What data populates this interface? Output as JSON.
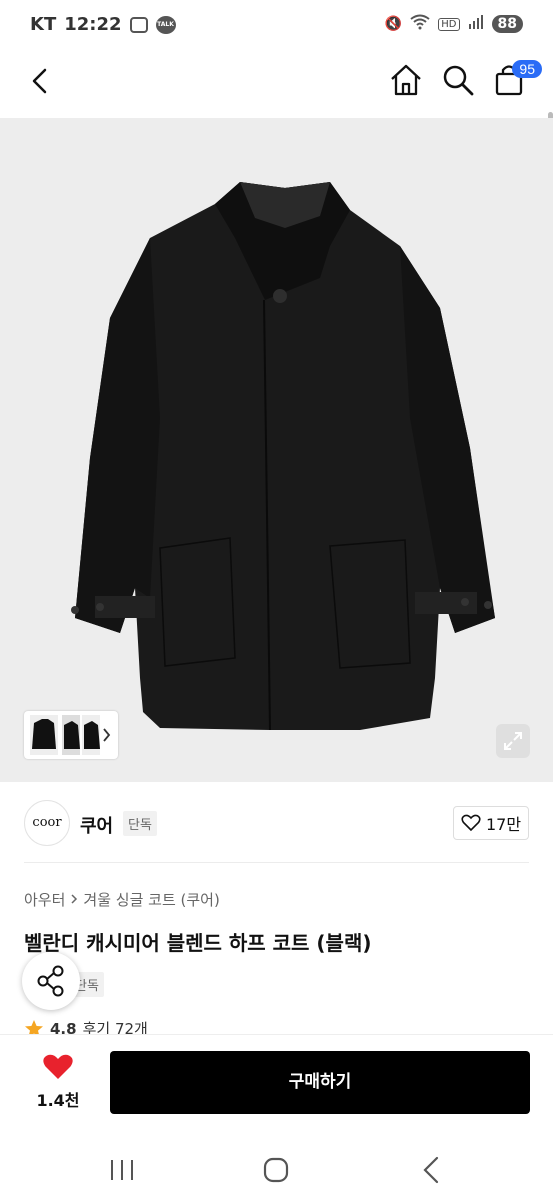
{
  "status_bar": {
    "carrier": "KT",
    "time": "12:22",
    "talk_label": "TALK",
    "network_label": "HD",
    "battery": "88"
  },
  "top_nav": {
    "cart_count": "95"
  },
  "brand": {
    "logo_text": "coor",
    "name": "쿠어",
    "tag": "단독",
    "like_count": "17만"
  },
  "product": {
    "breadcrumb": [
      "아우터",
      "겨울 싱글 코트 (쿠어)"
    ],
    "title": "벨란디 캐시미어 블렌드 하프 코트 (블랙)",
    "exclusive_tag": "단독",
    "rating": "4.8",
    "review_label": "후기 72개"
  },
  "bottom_bar": {
    "like_count": "1.4천",
    "buy_label": "구매하기"
  },
  "colors": {
    "accent_blue": "#2a6cf6",
    "heart_red": "#e8222d",
    "star": "#f5a623",
    "buy_bg": "#000000"
  },
  "icons": [
    "back-icon",
    "home-icon",
    "search-icon",
    "cart-icon",
    "expand-icon",
    "heart-outline-icon",
    "share-icon",
    "star-icon",
    "heart-filled-icon",
    "recent-apps-icon",
    "home-circle-icon",
    "system-back-icon"
  ]
}
